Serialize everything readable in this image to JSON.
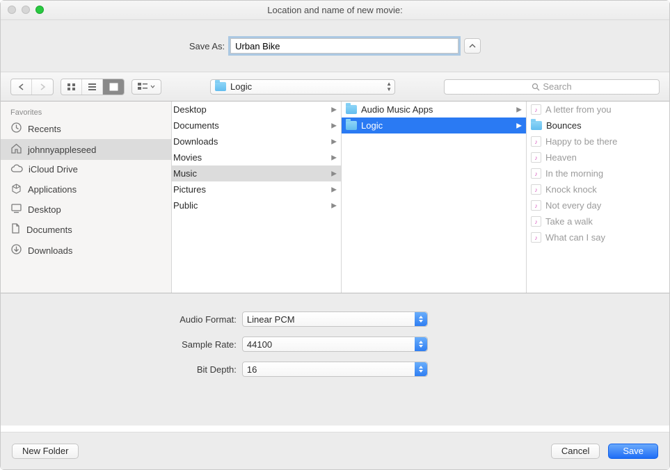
{
  "titlebar": {
    "title": "Location and name of new movie:"
  },
  "saveas": {
    "label": "Save As:",
    "value": "Urban Bike"
  },
  "toolbar": {
    "location": "Logic",
    "search_placeholder": "Search"
  },
  "sidebar": {
    "header": "Favorites",
    "items": [
      {
        "label": "Recents",
        "icon": "clock"
      },
      {
        "label": "johnnyappleseed",
        "icon": "home",
        "selected": true
      },
      {
        "label": "iCloud Drive",
        "icon": "cloud"
      },
      {
        "label": "Applications",
        "icon": "apps"
      },
      {
        "label": "Desktop",
        "icon": "desktop"
      },
      {
        "label": "Documents",
        "icon": "doc"
      },
      {
        "label": "Downloads",
        "icon": "download"
      }
    ]
  },
  "col1": [
    {
      "label": "Desktop"
    },
    {
      "label": "Documents"
    },
    {
      "label": "Downloads"
    },
    {
      "label": "Movies"
    },
    {
      "label": "Music",
      "selected": true
    },
    {
      "label": "Pictures"
    },
    {
      "label": "Public"
    }
  ],
  "col2": [
    {
      "label": "Audio Music Apps"
    },
    {
      "label": "Logic",
      "selected": true
    }
  ],
  "col3": [
    {
      "label": "A letter from you"
    },
    {
      "label": "Bounces",
      "folder": true,
      "bold": true
    },
    {
      "label": "Happy to be there"
    },
    {
      "label": "Heaven"
    },
    {
      "label": "In the morning"
    },
    {
      "label": "Knock knock"
    },
    {
      "label": "Not every day"
    },
    {
      "label": "Take a walk"
    },
    {
      "label": "What can I say"
    }
  ],
  "options": {
    "audio_format": {
      "label": "Audio Format:",
      "value": "Linear PCM"
    },
    "sample_rate": {
      "label": "Sample Rate:",
      "value": "44100"
    },
    "bit_depth": {
      "label": "Bit Depth:",
      "value": "16"
    }
  },
  "bottom": {
    "new_folder": "New Folder",
    "cancel": "Cancel",
    "save": "Save"
  }
}
